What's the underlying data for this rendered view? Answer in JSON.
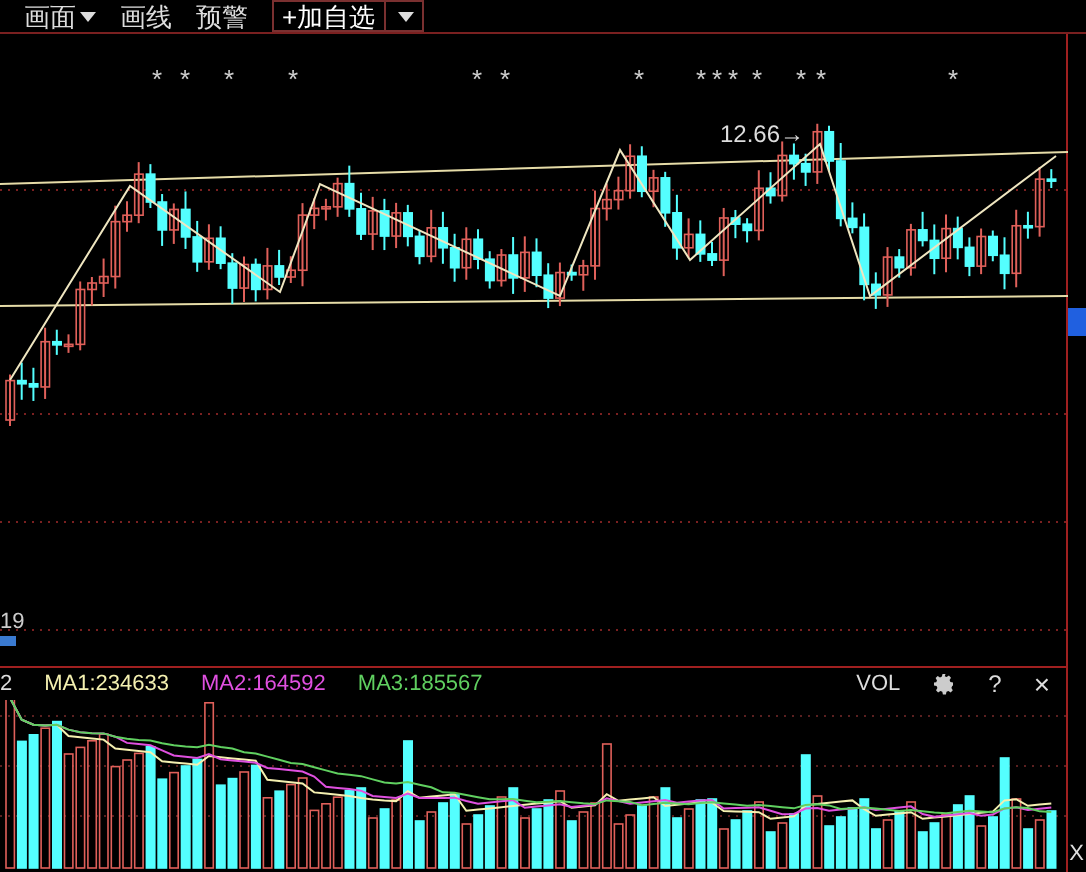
{
  "toolbar": {
    "items": [
      {
        "label": "画面",
        "kind": "menu"
      },
      {
        "label": "画线",
        "kind": "plain"
      },
      {
        "label": "预警",
        "kind": "plain"
      },
      {
        "label": "+加自选",
        "kind": "button"
      }
    ]
  },
  "main_chart": {
    "signal_marks": [
      "*",
      "*",
      "*",
      "*",
      "*",
      "*",
      "*",
      "*",
      "*",
      "*",
      "*",
      "*",
      "*",
      "*"
    ],
    "peak_label": "12.66→",
    "axis_label": "19"
  },
  "volume_pane": {
    "index_label": "2",
    "ma": [
      {
        "label": "MA1:234633",
        "color": "#f4f0b0"
      },
      {
        "label": "MA2:164592",
        "color": "#e050e0"
      },
      {
        "label": "MA3:185567",
        "color": "#60d060"
      }
    ],
    "title": "VOL",
    "help": "?",
    "close": "×",
    "edge_label": "X"
  }
}
